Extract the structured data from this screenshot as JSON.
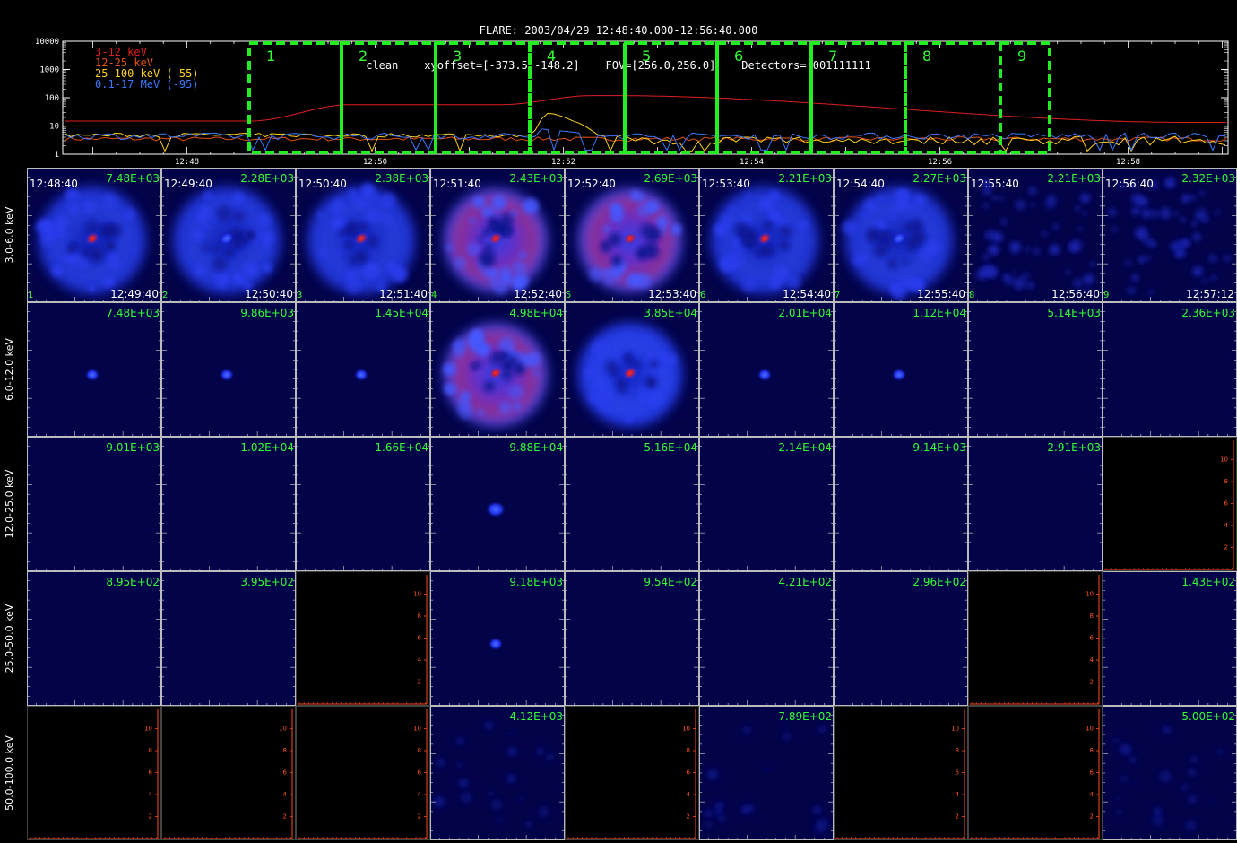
{
  "header": {
    "line1": "FLARE: 2003/04/29 12:48:40.000-12:56:40.000",
    "line2": "clean    xyoffset=[-373.5,-148.2]    FOV=[256.0,256.0]    Detectors= 001111111"
  },
  "lightcurve": {
    "y_ticks": [
      "10000",
      "1000",
      "100",
      "10",
      "1"
    ],
    "x_ticks": [
      "12:48",
      "12:50",
      "12:52",
      "12:54",
      "12:56",
      "12:58"
    ],
    "legend": [
      {
        "label": "3-12 keV",
        "color": "#e0201c"
      },
      {
        "label": "12-25 keV",
        "color": "#e05010"
      },
      {
        "label": "25-100 keV (-55)",
        "color": "#ffd21e"
      },
      {
        "label": "0.1-17 MeV (-95)",
        "color": "#3c78ff"
      }
    ],
    "intervals": [
      "1",
      "2",
      "3",
      "4",
      "5",
      "6",
      "7",
      "8",
      "9"
    ],
    "interval_color": "#22ee22"
  },
  "grid": {
    "energy_bands": [
      "3.0-6.0 keV",
      "6.0-12.0 keV",
      "12.0-25.0 keV",
      "25.0-50.0 keV",
      "50.0-100.0 keV"
    ],
    "start_times": [
      "12:48:40",
      "12:49:40",
      "12:50:40",
      "12:51:40",
      "12:52:40",
      "12:53:40",
      "12:54:40",
      "12:55:40",
      "12:56:40"
    ],
    "end_times": [
      "12:49:40",
      "12:50:40",
      "12:51:40",
      "12:52:40",
      "12:53:40",
      "12:54:40",
      "12:55:40",
      "12:56:40",
      "12:57:12"
    ],
    "frame_numbers": [
      "1",
      "2",
      "3",
      "4",
      "5",
      "6",
      "7",
      "8",
      "9"
    ],
    "max_values": [
      [
        "7.48E+03",
        "2.28E+03",
        "2.38E+03",
        "2.43E+03",
        "2.69E+03",
        "2.21E+03",
        "2.27E+03",
        "2.21E+03",
        "2.32E+03"
      ],
      [
        "7.48E+03",
        "9.86E+03",
        "1.45E+04",
        "4.98E+04",
        "3.85E+04",
        "2.01E+04",
        "1.12E+04",
        "5.14E+03",
        "2.36E+03"
      ],
      [
        "9.01E+03",
        "1.02E+04",
        "1.66E+04",
        "9.88E+04",
        "5.16E+04",
        "2.14E+04",
        "9.14E+03",
        "2.91E+03",
        ""
      ],
      [
        "8.95E+02",
        "3.95E+02",
        "",
        "9.18E+03",
        "9.54E+02",
        "4.21E+02",
        "2.96E+02",
        "",
        "1.43E+02"
      ],
      [
        "",
        "",
        "",
        "4.12E+03",
        "",
        "7.89E+02",
        "",
        "",
        "5.00E+02"
      ]
    ],
    "empty_axis_ticks": [
      "2",
      "4",
      "6",
      "8",
      "10"
    ]
  }
}
